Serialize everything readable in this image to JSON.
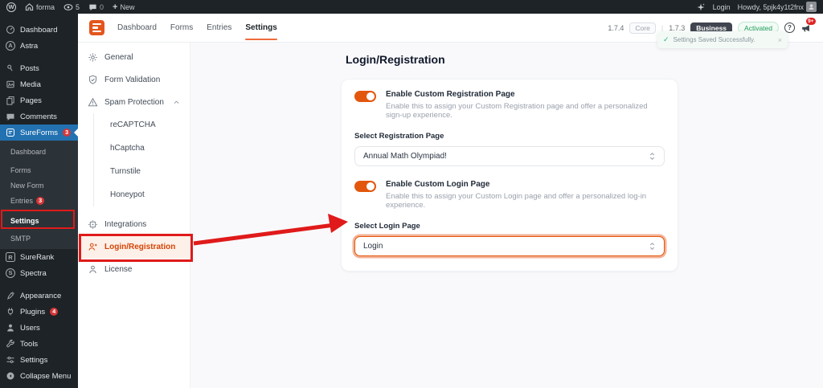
{
  "admin_bar": {
    "site_name": "forma",
    "updates_count": "5",
    "comments_count": "0",
    "new_label": "New",
    "login_label": "Login",
    "howdy_label": "Howdy, 5pjk4y1t2fnx"
  },
  "glyphs": {
    "wp": "W",
    "astra": "A",
    "spectra": "S",
    "surerank": "R",
    "question": "?",
    "close": "×",
    "check": "✓",
    "plus": "+",
    "collapse": "◀"
  },
  "wp_sidebar": {
    "items_top": [
      {
        "label": "Dashboard",
        "icon": "gauge-icon"
      },
      {
        "label": "Astra",
        "icon": "astra-icon"
      },
      {
        "label": "Posts",
        "icon": "pin-icon"
      },
      {
        "label": "Media",
        "icon": "media-icon"
      },
      {
        "label": "Pages",
        "icon": "pages-icon"
      },
      {
        "label": "Comments",
        "icon": "comment-icon"
      },
      {
        "label": "SureForms",
        "icon": "sureforms-icon",
        "badge": "3",
        "active": true
      }
    ],
    "sureforms_submenu": [
      {
        "label": "Dashboard"
      },
      {
        "label": "Forms"
      },
      {
        "label": "New Form"
      },
      {
        "label": "Entries",
        "badge": "3"
      },
      {
        "label": "Settings",
        "current": true
      },
      {
        "label": "SMTP"
      }
    ],
    "items_lower": [
      {
        "label": "SureRank",
        "icon": "surerank-icon"
      },
      {
        "label": "Spectra",
        "icon": "spectra-icon"
      },
      {
        "label": "Appearance",
        "icon": "brush-icon"
      },
      {
        "label": "Plugins",
        "icon": "plug-icon",
        "badge": "4"
      },
      {
        "label": "Users",
        "icon": "users-icon"
      },
      {
        "label": "Tools",
        "icon": "wrench-icon"
      },
      {
        "label": "Settings",
        "icon": "sliders-icon"
      },
      {
        "label": "Collapse Menu",
        "icon": "collapse-icon"
      }
    ]
  },
  "plugin_header": {
    "tabs": [
      {
        "label": "Dashboard"
      },
      {
        "label": "Forms"
      },
      {
        "label": "Entries"
      },
      {
        "label": "Settings",
        "active": true
      }
    ],
    "core_version": "1.7.4",
    "core_badge": "Core",
    "divider": "|",
    "pro_version": "1.7.3",
    "business_badge": "Business",
    "activated_badge": "Activated",
    "notification_count": "9+"
  },
  "toast": {
    "message": "Settings Saved Successfully."
  },
  "settings_nav": {
    "items_top": [
      {
        "label": "General",
        "icon": "gear-icon"
      },
      {
        "label": "Form Validation",
        "icon": "shield-check-icon"
      },
      {
        "label": "Spam Protection",
        "icon": "warning-icon",
        "expanded": true
      }
    ],
    "spam_sub": [
      {
        "label": "reCAPTCHA"
      },
      {
        "label": "hCaptcha"
      },
      {
        "label": "Turnstile"
      },
      {
        "label": "Honeypot"
      }
    ],
    "items_lower": [
      {
        "label": "Integrations",
        "icon": "integrations-icon"
      },
      {
        "label": "Login/Registration",
        "icon": "user-plus-icon",
        "active": true
      },
      {
        "label": "License",
        "icon": "user-icon"
      }
    ]
  },
  "main": {
    "title": "Login/Registration",
    "registration": {
      "toggle_label": "Enable Custom Registration Page",
      "toggle_on": true,
      "toggle_desc": "Enable this to assign your Custom Registration page and offer a personalized sign-up experience.",
      "select_label": "Select Registration Page",
      "select_value": "Annual Math Olympiad!"
    },
    "login": {
      "toggle_label": "Enable Custom Login Page",
      "toggle_on": true,
      "toggle_desc": "Enable this to assign your Custom Login page and offer a personalized log-in experience.",
      "select_label": "Select Login Page",
      "select_value": "Login"
    }
  },
  "colors": {
    "accent": "#D54407",
    "toggle_orange": "#E2570D",
    "annotation_red": "#E01A1A",
    "wp_active_blue": "#2271b1",
    "badge_red": "#d63638",
    "success_green": "#1E9E57"
  }
}
